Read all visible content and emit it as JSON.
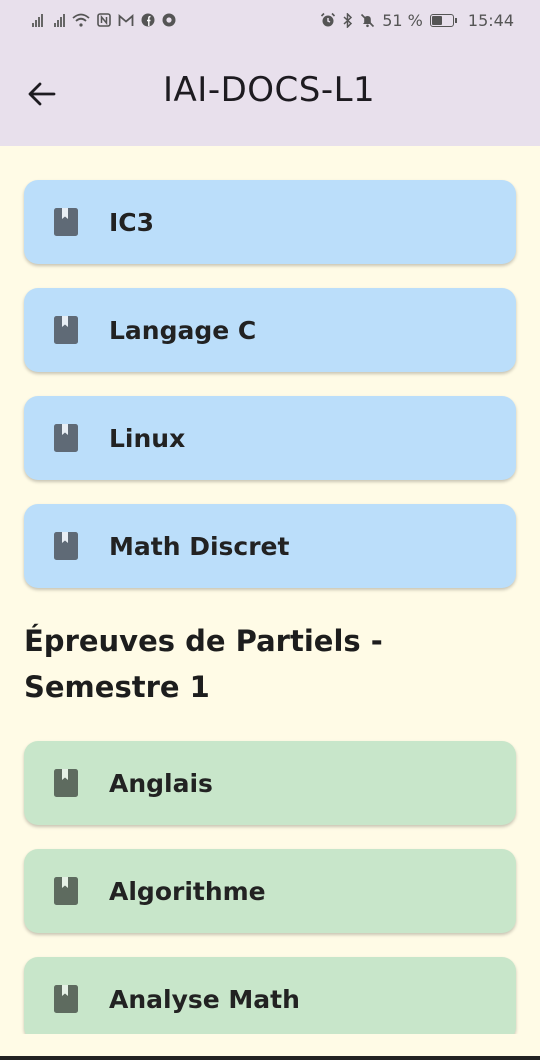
{
  "status_bar": {
    "battery_percent": "51 %",
    "battery_level": 0.51,
    "time": "15:44"
  },
  "app_bar": {
    "title": "IAI-DOCS-L1"
  },
  "courses": [
    {
      "label": "IC3"
    },
    {
      "label": "Langage C"
    },
    {
      "label": "Linux"
    },
    {
      "label": "Math Discret"
    }
  ],
  "exams_section": {
    "title": "Épreuves de Partiels - Semestre 1",
    "items": [
      {
        "label": "Anglais"
      },
      {
        "label": "Algorithme"
      },
      {
        "label": "Analyse Math"
      }
    ]
  },
  "colors": {
    "course_card": "#bbdefa",
    "exam_card": "#c8e6ca",
    "course_icon": "#5f6a76",
    "exam_icon": "#5e6b5f",
    "app_bar": "#e8e0ec",
    "background": "#fffbe6"
  },
  "icons": [
    "signal-icon",
    "wifi-icon",
    "nfc-icon",
    "gmail-icon",
    "facebook-icon",
    "chrome-icon",
    "alarm-icon",
    "bluetooth-icon",
    "mute-icon",
    "battery-icon",
    "back-arrow-icon",
    "book-icon"
  ]
}
